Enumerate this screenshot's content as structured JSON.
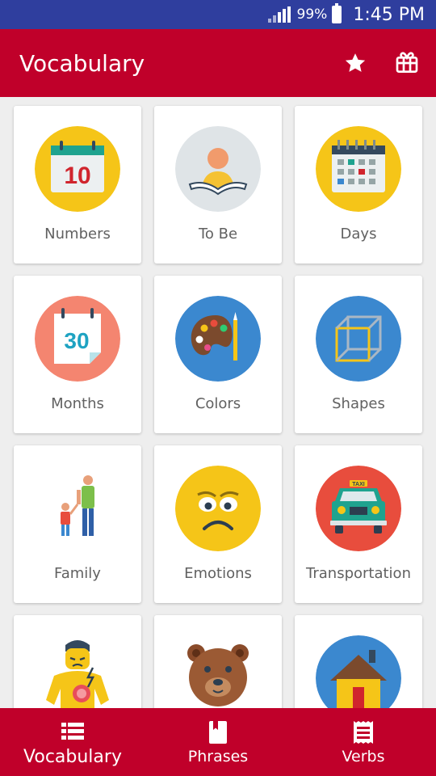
{
  "status_bar": {
    "battery": "99%",
    "time": "1:45 PM"
  },
  "app_bar": {
    "title": "Vocabulary",
    "actions": [
      {
        "icon": "star-icon"
      },
      {
        "icon": "gift-icon"
      }
    ]
  },
  "categories": [
    {
      "label": "Numbers",
      "icon": "calendar-number-icon",
      "color": "#f5c518"
    },
    {
      "label": "To Be",
      "icon": "person-reading-icon",
      "color": "#dfe4e7"
    },
    {
      "label": "Days",
      "icon": "calendar-grid-icon",
      "color": "#f5c518"
    },
    {
      "label": "Months",
      "icon": "calendar-page-icon",
      "color": "#f48570"
    },
    {
      "label": "Colors",
      "icon": "palette-icon",
      "color": "#3b88cf"
    },
    {
      "label": "Shapes",
      "icon": "cube-icon",
      "color": "#3b88cf"
    },
    {
      "label": "Family",
      "icon": "family-icon",
      "color": "#ffffff"
    },
    {
      "label": "Emotions",
      "icon": "worried-face-icon",
      "color": "#f5c518"
    },
    {
      "label": "Transportation",
      "icon": "taxi-icon",
      "color": "#e84d3d"
    },
    {
      "label": "",
      "icon": "body-pain-icon",
      "color": "#ffffff"
    },
    {
      "label": "",
      "icon": "bear-icon",
      "color": "#ffffff"
    },
    {
      "label": "",
      "icon": "house-icon",
      "color": "#3b88cf"
    }
  ],
  "calendar_numbers": {
    "numbers": "10",
    "months": "30"
  },
  "taxi_sign": "TAXI",
  "bottom_nav": [
    {
      "label": "Vocabulary",
      "icon": "list-icon",
      "active": true
    },
    {
      "label": "Phrases",
      "icon": "book-icon",
      "active": false
    },
    {
      "label": "Verbs",
      "icon": "receipt-icon",
      "active": false
    }
  ]
}
